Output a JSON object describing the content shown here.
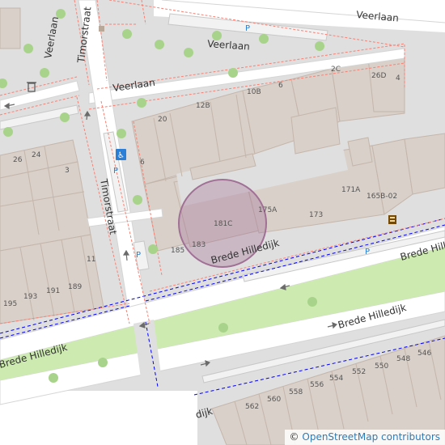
{
  "map": {
    "colors": {
      "land": "#e0dfdf",
      "building": "#d9d0c9",
      "building_edge": "#c4b6ab",
      "road": "#ffffff",
      "road_casing": "#d5d5d5",
      "footway": "#fa8072",
      "cycleway": "#0000ff",
      "grass": "#cdebb0",
      "tree": "#a8d38a",
      "marker_fill": "#a07095",
      "parking": "#2b7fd6"
    },
    "streets": [
      {
        "name": "Veerlaan"
      },
      {
        "name": "Veerlaan"
      },
      {
        "name": "Veerlaan"
      },
      {
        "name": "Veerlaan"
      },
      {
        "name": "Timorstraat"
      },
      {
        "name": "Timorstraat"
      },
      {
        "name": "Brede Hilledijk"
      },
      {
        "name": "Brede Hilledijk"
      },
      {
        "name": "Brede Hilledijk"
      },
      {
        "name": "Brede Hilledijk"
      },
      {
        "name": "dijk"
      }
    ],
    "house_numbers": [
      "2C",
      "26D",
      "4",
      "6",
      "10B",
      "12B",
      "20",
      "6",
      "171A",
      "165B-02",
      "175A",
      "173",
      "181C",
      "183",
      "185",
      "26",
      "24",
      "3",
      "11",
      "189",
      "191",
      "193",
      "195",
      "548",
      "546",
      "550",
      "552",
      "554",
      "556",
      "558",
      "560",
      "562"
    ],
    "marker_label": "181C",
    "parking_label": "P"
  },
  "attribution": {
    "symbol": "©",
    "text": "OpenStreetMap contributors"
  }
}
